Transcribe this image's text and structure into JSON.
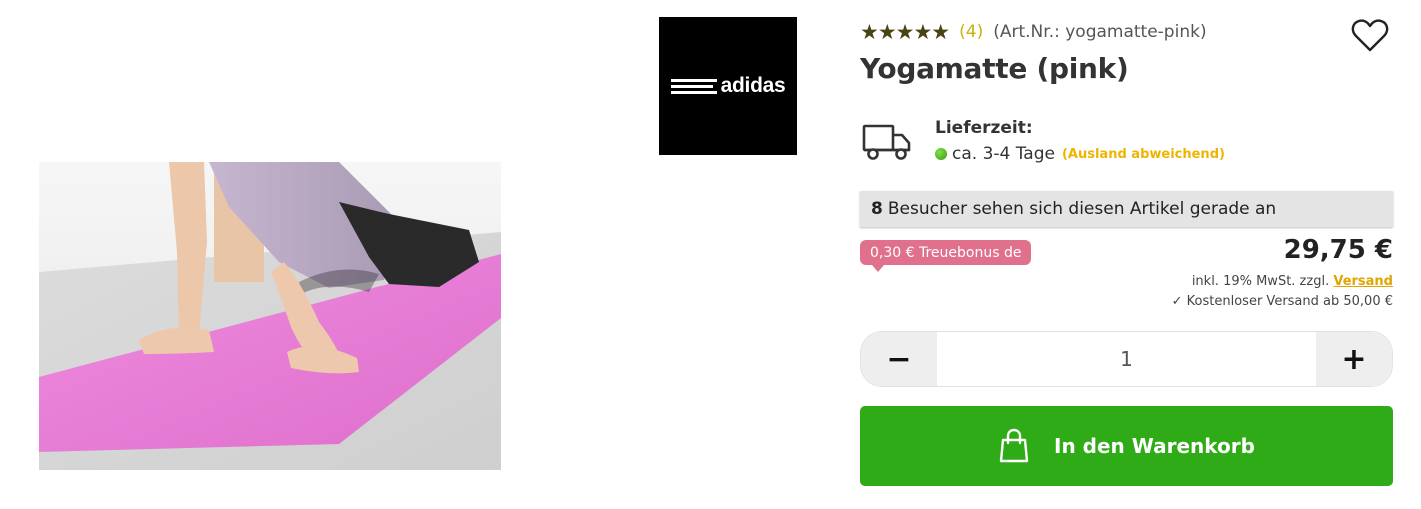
{
  "product": {
    "rating_stars": "★★★★★",
    "review_count": "(4)",
    "article_number": "(Art.Nr.: yogamatte-pink)",
    "title": "Yogamatte (pink)",
    "brand": "adidas"
  },
  "delivery": {
    "label": "Lieferzeit:",
    "time": "ca. 3-4 Tage",
    "note": "(Ausland abweichend)",
    "status_color": "#4caf1c"
  },
  "visitors": {
    "count": "8",
    "text": "Besucher sehen sich diesen Artikel gerade an"
  },
  "pricing": {
    "loyalty_bonus": "0,30 € Treuebonus de",
    "price": "29,75 €",
    "tax_text": "inkl. 19% MwSt. zzgl.",
    "shipping_link": "Versand",
    "free_shipping": "✓ Kostenloser Versand ab 50,00 €"
  },
  "quantity": {
    "value": "1",
    "minus": "−",
    "plus": "+"
  },
  "cart": {
    "label": "In den Warenkorb"
  },
  "icons": {
    "wishlist": "heart-icon",
    "delivery": "truck-icon",
    "cart": "shopping-bag-icon"
  },
  "colors": {
    "accent_green": "#2eab16",
    "bonus_pink": "#e0708c",
    "link_yellow": "#e0a500",
    "star_color": "#4a4415"
  }
}
